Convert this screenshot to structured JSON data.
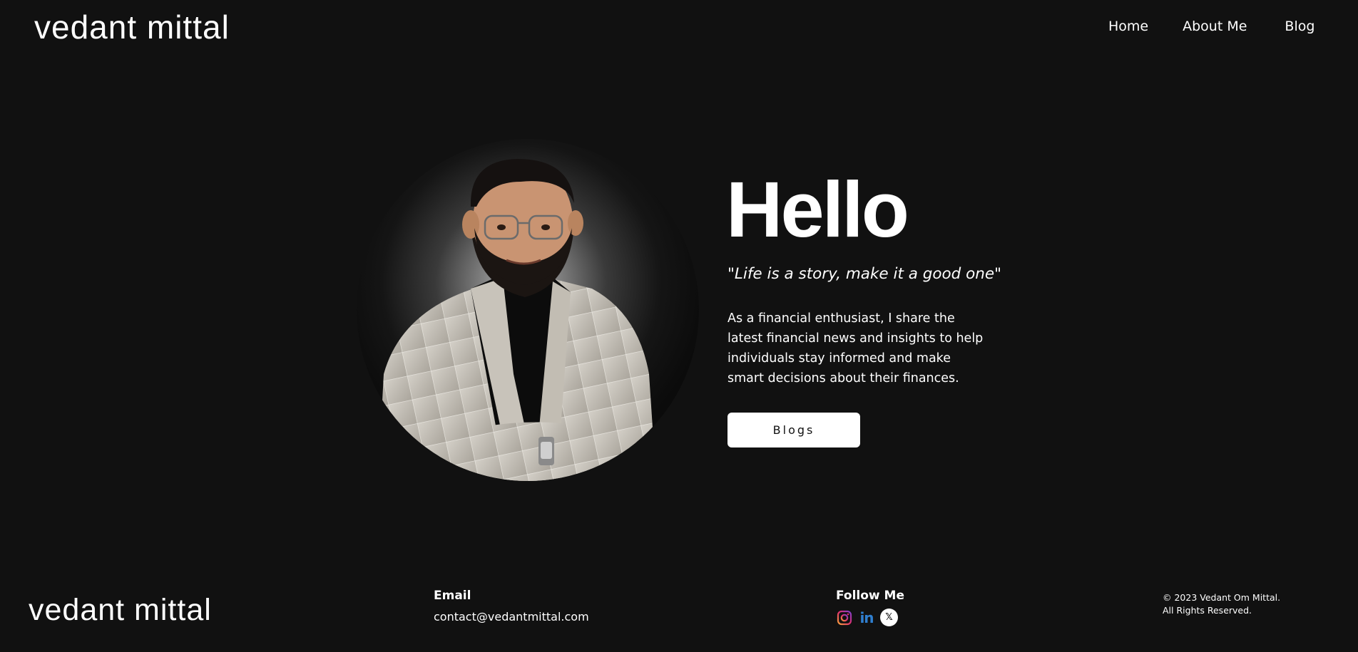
{
  "header": {
    "logo": "vedant mittal",
    "nav": {
      "home": "Home",
      "about": "About Me",
      "blog": "Blog"
    }
  },
  "hero": {
    "portrait_icon": "portrait-photo",
    "heading": "Hello",
    "quote": "\"Life is a story, make it a good one\"",
    "description": "As a financial enthusiast, I share the latest financial news and insights to help individuals stay informed and make smart decisions about their finances.",
    "button_label": "Blogs"
  },
  "footer": {
    "logo": "vedant mittal",
    "email_title": "Email",
    "email_address": "contact@vedantmittal.com",
    "follow_title": "Follow Me",
    "socials": {
      "instagram_icon": "instagram-icon",
      "linkedin_label": "in",
      "x_label": "𝕏"
    },
    "copyright_line1": "© 2023 Vedant Om Mittal.",
    "copyright_line2": "All Rights Reserved."
  },
  "colors": {
    "background": "#111111",
    "text": "#ffffff",
    "button_bg": "#ffffff",
    "button_text": "#111111",
    "linkedin": "#2f7fd0"
  }
}
